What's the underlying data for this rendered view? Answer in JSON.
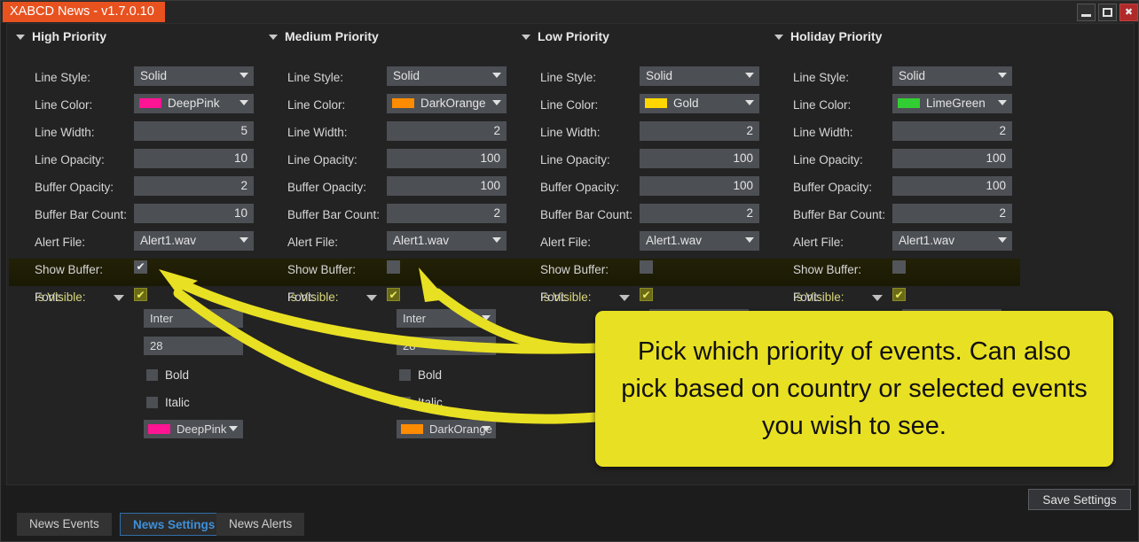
{
  "window": {
    "title": "XABCD News - v1.7.0.10",
    "controls": [
      {
        "name": "minimize",
        "glyph": ""
      },
      {
        "name": "maximize",
        "glyph": ""
      },
      {
        "name": "close",
        "glyph": "✖"
      }
    ]
  },
  "field_labels": {
    "line_style": "Line Style:",
    "line_color": "Line Color:",
    "line_width": "Line Width:",
    "line_opacity": "Line Opacity:",
    "buffer_opacity": "Buffer Opacity:",
    "buffer_bar_count": "Buffer Bar Count:",
    "alert_file": "Alert File:",
    "show_buffer": "Show Buffer:",
    "is_visible": "Is Visible:",
    "font": "Font:",
    "bold": "Bold",
    "italic": "Italic"
  },
  "columns": [
    {
      "title": "High Priority",
      "line_style": "Solid",
      "line_color": "DeepPink",
      "line_color_hex": "#ff1493",
      "line_width": "5",
      "line_opacity": "10",
      "buffer_opacity": "2",
      "buffer_bar_count": "10",
      "alert_file": "Alert1.wav",
      "show_buffer": true,
      "is_visible": true,
      "font_name": "Inter",
      "font_size": "28",
      "bold": false,
      "italic": false,
      "font_color": "DeepPink",
      "font_color_hex": "#ff1493",
      "font_visible": true
    },
    {
      "title": "Medium Priority",
      "line_style": "Solid",
      "line_color": "DarkOrange",
      "line_color_hex": "#ff8c00",
      "line_width": "2",
      "line_opacity": "100",
      "buffer_opacity": "100",
      "buffer_bar_count": "2",
      "alert_file": "Alert1.wav",
      "show_buffer": false,
      "is_visible": true,
      "font_name": "Inter",
      "font_size": "28",
      "bold": false,
      "italic": false,
      "font_color": "DarkOrange",
      "font_color_hex": "#ff8c00",
      "font_visible": true
    },
    {
      "title": "Low Priority",
      "line_style": "Solid",
      "line_color": "Gold",
      "line_color_hex": "#ffd700",
      "line_width": "2",
      "line_opacity": "100",
      "buffer_opacity": "100",
      "buffer_bar_count": "2",
      "alert_file": "Alert1.wav",
      "show_buffer": false,
      "is_visible": true,
      "font_name": "",
      "font_size": "",
      "bold": false,
      "italic": false,
      "font_color": "",
      "font_color_hex": "#ffd700",
      "font_visible": false
    },
    {
      "title": "Holiday Priority",
      "line_style": "Solid",
      "line_color": "LimeGreen",
      "line_color_hex": "#32cd32",
      "line_width": "2",
      "line_opacity": "100",
      "buffer_opacity": "100",
      "buffer_bar_count": "2",
      "alert_file": "Alert1.wav",
      "show_buffer": false,
      "is_visible": true,
      "font_name": "",
      "font_size": "",
      "bold": false,
      "italic": false,
      "font_color": "",
      "font_color_hex": "#32cd32",
      "font_visible": false
    }
  ],
  "callout": {
    "text": "Pick which priority of events.  Can also pick based on country or selected events you wish to see.",
    "background_hex": "#e8e022"
  },
  "save_button": {
    "label": "Save Settings"
  },
  "tabs": [
    {
      "label": "News Events",
      "active": false
    },
    {
      "label": "News Settings",
      "active": true
    },
    {
      "label": "News Alerts",
      "active": false
    }
  ]
}
